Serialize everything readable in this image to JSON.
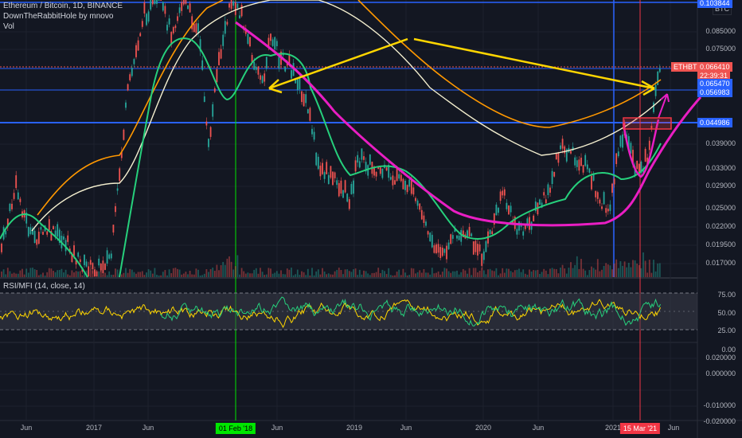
{
  "chart_data": {
    "type": "line",
    "title": "Ethereum / Bitcoin, 1D, BINANCE",
    "subtitle": "DownTheRabbitHole by mnovo",
    "volume_label": "Vol",
    "symbol_box": "BTC",
    "price_axis": {
      "scale": "log",
      "ticks": [
        "0.085000",
        "0.075000",
        "0.039000",
        "0.033000",
        "0.029000",
        "0.025000",
        "0.022000",
        "0.019500",
        "0.017000"
      ]
    },
    "price_tags": [
      {
        "name": "ETHBTC",
        "value": "0.066410",
        "countdown": "22:39:31",
        "color": "#ef5350"
      },
      {
        "name": "level-1",
        "value": "0.065470",
        "color": "#2962ff"
      },
      {
        "name": "level-2",
        "value": "0.056983",
        "color": "#2962ff"
      },
      {
        "name": "level-3",
        "value": "0.044986",
        "color": "#2962ff"
      },
      {
        "name": "top-level",
        "value": "0.103844",
        "color": "#2962ff"
      }
    ],
    "indicator": {
      "label": "RSI/MFI (14, close, 14)",
      "ticks": [
        "75.00",
        "50.00",
        "25.00",
        "0.00"
      ],
      "upper_band": 75,
      "lower_band": 25
    },
    "oscillator_axis": {
      "ticks": [
        "0.020000",
        "0.000000",
        "-0.010000",
        "-0.020000"
      ]
    },
    "time_axis": {
      "labels": [
        "Jun",
        "2017",
        "Jun",
        "Jun",
        "2019",
        "Jun",
        "2020",
        "Jun",
        "2021",
        "Jun"
      ],
      "markers": [
        {
          "label": "01 Feb '18",
          "color": "#00e600",
          "text_color": "#000000"
        },
        {
          "label": "15 Mar '21",
          "color": "#f23645",
          "text_color": "#ffffff"
        }
      ]
    },
    "grid": true,
    "colors": {
      "background": "#131722",
      "green_ma": "#26d07c",
      "white_ma": "#f5f0d0",
      "orange_ma": "#ff9800",
      "magenta_curve": "#e91ec3",
      "yellow_annotation": "#ffd600",
      "blue_line": "#2962ff",
      "candle_up": "#26a69a",
      "candle_down": "#ef5350"
    }
  }
}
